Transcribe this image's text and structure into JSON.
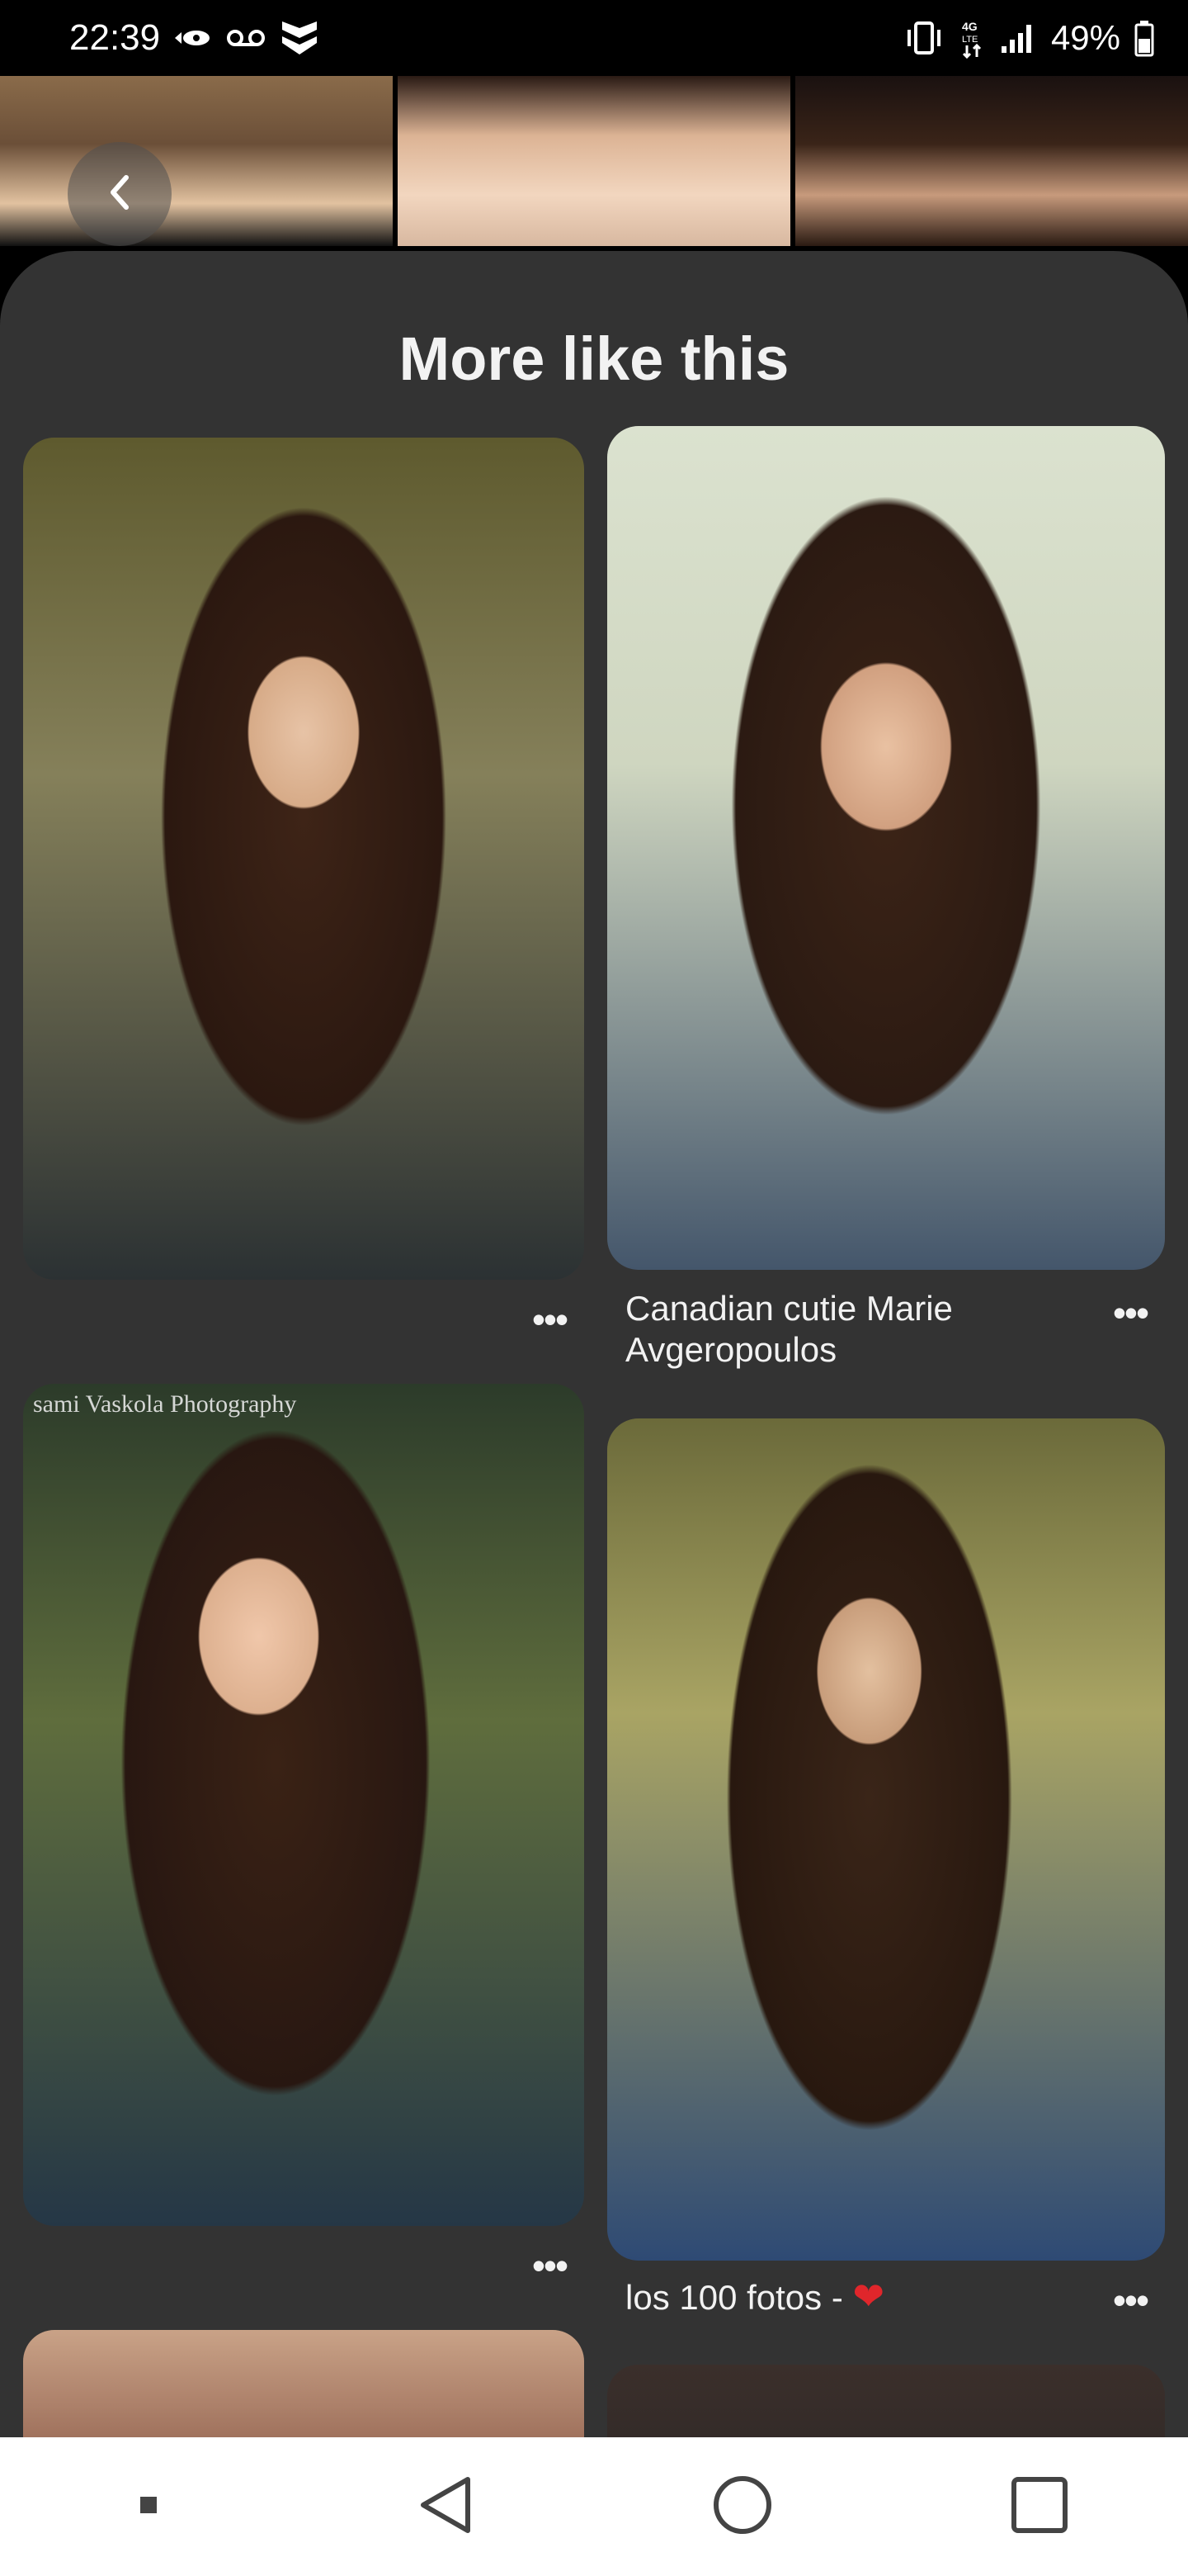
{
  "status_bar": {
    "time": "22:39",
    "battery": "49%",
    "icons": [
      "eye-icon",
      "voicemail-icon",
      "shield-icon",
      "vibrate-icon",
      "4g-lte-icon",
      "signal-icon",
      "battery-icon"
    ]
  },
  "nav": {
    "back_icon": "chevron-left-icon"
  },
  "section": {
    "title": "More like this"
  },
  "pins": [
    {
      "caption": "",
      "watermark": ""
    },
    {
      "caption": "Canadian cutie Marie Avgeropoulos",
      "watermark": ""
    },
    {
      "caption": "",
      "watermark": "sami Vaskola Photography"
    },
    {
      "caption": "los 100 fotos - ",
      "heart": "❤",
      "watermark": ""
    }
  ],
  "more_label": "•••",
  "system_nav": {
    "icons": [
      "recent-dot-icon",
      "back-triangle-icon",
      "home-circle-icon",
      "overview-square-icon"
    ]
  },
  "colors": {
    "sheet_bg": "#333333",
    "heart": "#e0262b"
  }
}
